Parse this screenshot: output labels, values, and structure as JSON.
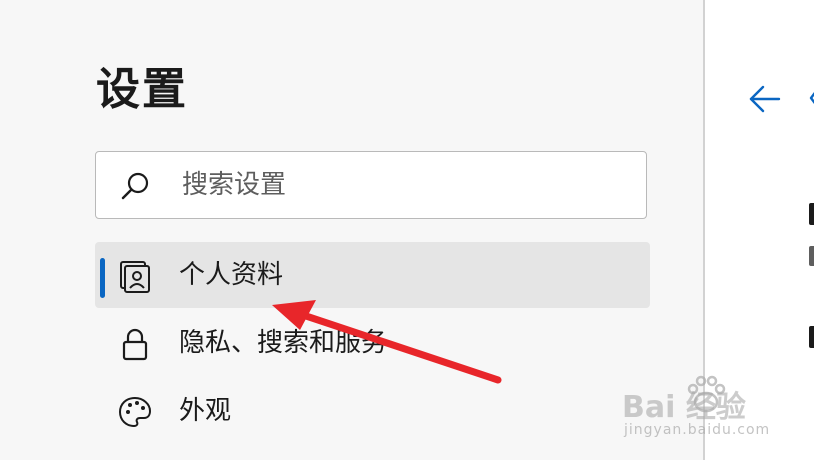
{
  "sidebar": {
    "title": "设置",
    "search": {
      "placeholder": "搜索设置",
      "value": "",
      "icon": "search-icon"
    },
    "items": [
      {
        "label": "个人资料",
        "icon": "profile-icon",
        "active": true
      },
      {
        "label": "隐私、搜索和服务",
        "icon": "lock-icon",
        "active": false
      },
      {
        "label": "外观",
        "icon": "palette-icon",
        "active": false
      }
    ]
  },
  "main": {
    "back_icon": "back-arrow-icon"
  },
  "annotation": {
    "arrow_color": "#e8262a",
    "points_to": "个人资料"
  },
  "watermark": {
    "main": "Bai 经验",
    "sub": "jingyan.baidu.com"
  },
  "colors": {
    "accent": "#0a66c2",
    "active_bg": "#e5e5e5",
    "sidebar_bg": "#f7f7f7"
  }
}
